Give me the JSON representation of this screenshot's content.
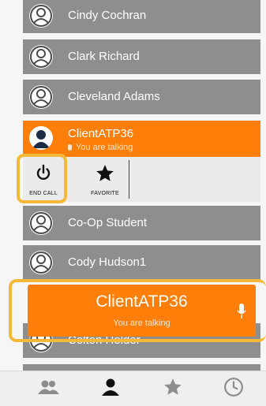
{
  "contacts": [
    {
      "name": "Cindy Cochran"
    },
    {
      "name": "Clark Richard"
    },
    {
      "name": "Cleveland Adams"
    },
    {
      "name": "ClientATP36",
      "status": "You are talking",
      "active": true
    },
    {
      "name": "Co-Op Student"
    },
    {
      "name": "Cody Hudson1"
    },
    {
      "name": "Colton Holder"
    }
  ],
  "actions": {
    "end_call": {
      "label": "END CALL",
      "icon": "power-icon"
    },
    "favorite": {
      "label": "FAVORITE",
      "icon": "star-icon"
    }
  },
  "call_banner": {
    "title": "ClientATP36",
    "status": "You are talking",
    "icon": "microphone-icon"
  },
  "tabs": [
    {
      "name": "groups",
      "icon": "people-icon"
    },
    {
      "name": "contacts",
      "icon": "person-icon",
      "selected": true
    },
    {
      "name": "favorites",
      "icon": "star-icon"
    },
    {
      "name": "recents",
      "icon": "clock-icon"
    }
  ],
  "colors": {
    "accent": "#ff7f0a",
    "row": "#8e8e8e",
    "highlight": "#f5b93a"
  }
}
